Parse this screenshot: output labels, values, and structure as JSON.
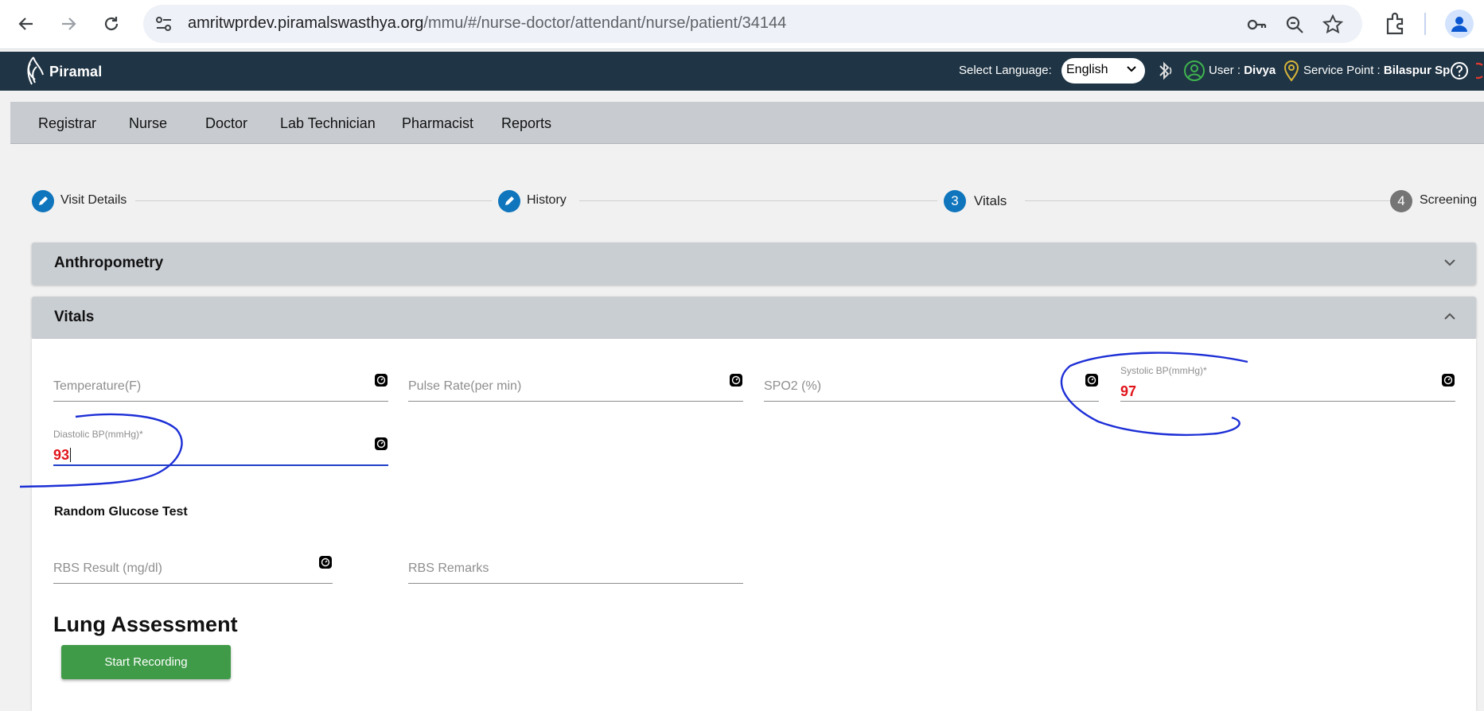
{
  "browser": {
    "url_host": "amritwprdev.piramalswasthya.org",
    "url_path": "/mmu/#/nurse-doctor/attendant/nurse/patient/34144"
  },
  "header": {
    "logo_text": "Piramal",
    "select_language_label": "Select Language:",
    "language_value": "English",
    "user_label": "User :",
    "user_name": "Divya",
    "service_point_label": "Service Point :",
    "service_point_name": "Bilaspur Sp"
  },
  "role_menu": [
    "Registrar",
    "Nurse",
    "Doctor",
    "Lab Technician",
    "Pharmacist",
    "Reports"
  ],
  "stepper": {
    "steps": [
      {
        "label": "Visit Details",
        "marker": "edit-icon"
      },
      {
        "label": "History",
        "marker": "edit-icon"
      },
      {
        "number": "3",
        "label": "Vitals"
      },
      {
        "number": "4",
        "label": "Screening"
      }
    ],
    "colors": {
      "active": "#0f75bc",
      "inactive": "#757575"
    }
  },
  "panels": {
    "anthropometry": {
      "title": "Anthropometry"
    },
    "vitals": {
      "title": "Vitals"
    }
  },
  "vitals_fields": {
    "temperature": {
      "placeholder": "Temperature(F)"
    },
    "pulse_rate": {
      "placeholder": "Pulse Rate(per min)"
    },
    "spo2": {
      "placeholder": "SPO2 (%)"
    },
    "systolic_bp": {
      "label": "Systolic BP(mmHg)*",
      "value": "97"
    },
    "diastolic_bp": {
      "label": "Diastolic BP(mmHg)*",
      "value": "93"
    }
  },
  "random_glucose": {
    "title": "Random Glucose Test",
    "rbs_result": {
      "placeholder": "RBS Result (mg/dl)"
    },
    "rbs_remarks": {
      "placeholder": "RBS Remarks"
    }
  },
  "lung_assessment": {
    "title": "Lung Assessment",
    "button_label": "Start Recording"
  },
  "colors": {
    "header_bg": "#1f3444",
    "error_value": "#e0151b",
    "focus_underline": "#1e3fc8",
    "button_green": "#3f9b48",
    "annotation_ink": "#1d2fd6"
  }
}
